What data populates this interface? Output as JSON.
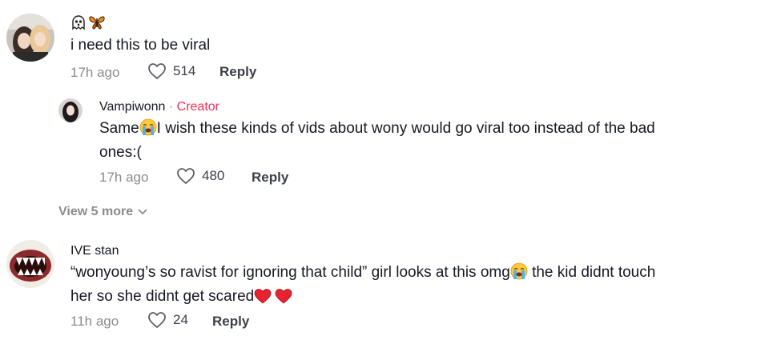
{
  "comments": [
    {
      "username": "",
      "text": "i need this to be viral",
      "time": "17h ago",
      "likes": "514",
      "reply_label": "Reply",
      "reply": {
        "username": "Vampiwonn",
        "separator": " · ",
        "badge": "Creator",
        "text_before": "Same",
        "text_after": "I wish these kinds of vids about wony would go viral too instead of the bad",
        "text_line2": "ones:(",
        "time": "17h ago",
        "likes": "480",
        "reply_label": "Reply"
      },
      "view_more": "View 5 more"
    },
    {
      "username": "IVE stan",
      "text_line1_before": "“wonyoung’s so ravist for ignoring that child” girl looks at this omg",
      "text_line1_after": " the kid didnt touch",
      "text_line2": "her so she didnt get scared",
      "time": "11h ago",
      "likes": "24",
      "reply_label": "Reply"
    }
  ],
  "colors": {
    "creator": "#fe2c55",
    "meta": "#8a8b91",
    "text": "#161823"
  },
  "icons": [
    "heart-icon",
    "chevron-down-icon",
    "crying-emoji-icon",
    "red-heart-emoji-icon",
    "ghost-emoji-icon",
    "butterfly-emoji-icon"
  ]
}
